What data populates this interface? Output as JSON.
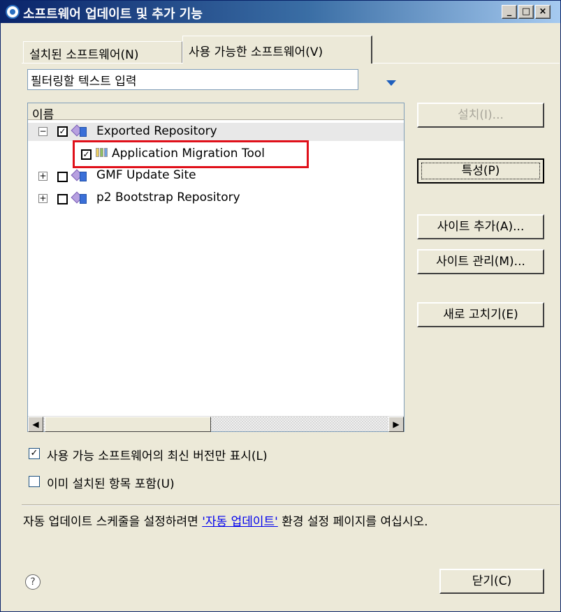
{
  "window": {
    "title": "소프트웨어 업데이트 및 추가 기능",
    "minimize_glyph": "_",
    "maximize_glyph": "□",
    "close_glyph": "×"
  },
  "tabs": [
    {
      "label": "설치된 소프트웨어(N)",
      "active": false
    },
    {
      "label": "사용 가능한 소프트웨어(V)",
      "active": true
    }
  ],
  "filter": {
    "placeholder": "필터링할 텍스트 입력"
  },
  "tree": {
    "column_header": "이름",
    "rows": [
      {
        "label": "Exported Repository",
        "level": 0,
        "expanded": true,
        "checked": true,
        "icon": "repository-icon"
      },
      {
        "label": "Application Migration Tool",
        "level": 1,
        "checked": true,
        "icon": "feature-icon"
      },
      {
        "label": "GMF Update Site",
        "level": 0,
        "expanded": false,
        "checked": false,
        "icon": "repository-icon"
      },
      {
        "label": "p2 Bootstrap Repository",
        "level": 0,
        "expanded": false,
        "checked": false,
        "icon": "repository-icon"
      }
    ]
  },
  "buttons": {
    "install": "설치(I)...",
    "properties": "특성(P)",
    "add_site": "사이트 추가(A)...",
    "manage_sites": "사이트 관리(M)...",
    "refresh": "새로 고치기(E)",
    "close": "닫기(C)"
  },
  "options": {
    "show_latest": {
      "label": "사용 가능 소프트웨어의 최신 버전만 표시(L)",
      "checked": true
    },
    "include_installed": {
      "label": "이미 설치된 항목 포함(U)",
      "checked": false
    }
  },
  "info": {
    "prefix": "자동 업데이트 스케줄을 설정하려면 ",
    "link": "'자동 업데이트'",
    "suffix": " 환경 설정 페이지를 여십시오."
  },
  "colors": {
    "highlight_box": "#e0101a",
    "link": "#0000ee",
    "titlebar": "#0a246a"
  }
}
